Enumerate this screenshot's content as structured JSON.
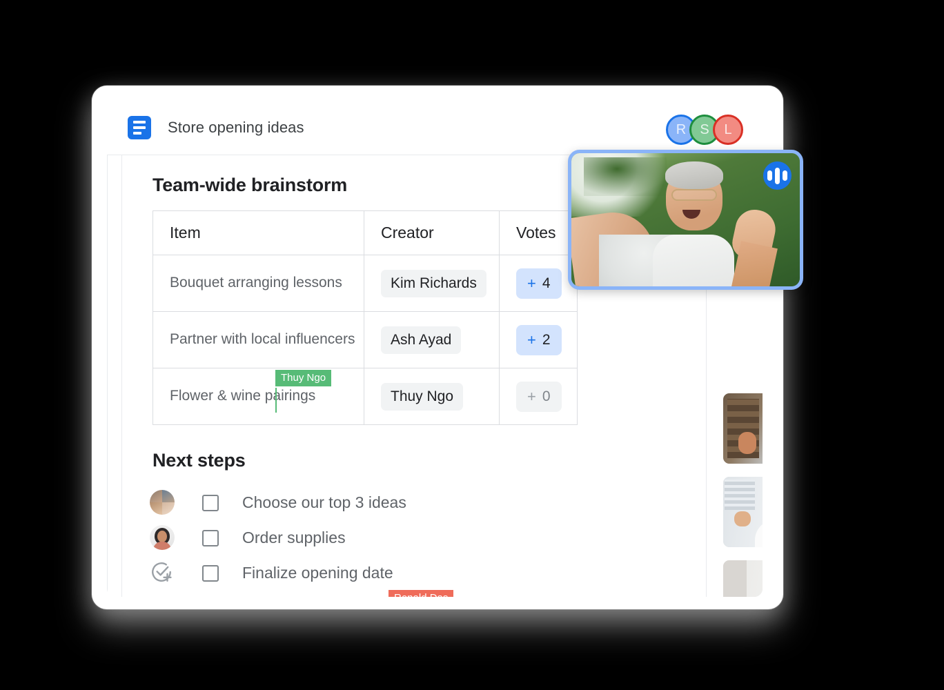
{
  "document": {
    "app_icon": "docs-icon",
    "title": "Store opening ideas",
    "collaborators": [
      {
        "initial": "R",
        "color": "#8ab4f8",
        "ring": "#1a73e8"
      },
      {
        "initial": "S",
        "color": "#81c995",
        "ring": "#1e8e3e"
      },
      {
        "initial": "L",
        "color": "#f28b82",
        "ring": "#d93025"
      }
    ],
    "brainstorm": {
      "heading": "Team-wide brainstorm",
      "columns": [
        "Item",
        "Creator",
        "Votes"
      ],
      "rows": [
        {
          "item": "Bouquet arranging lessons",
          "creator": "Kim Richards",
          "vote_plus": "+",
          "vote_count": "4",
          "vote_state": "active"
        },
        {
          "item": "Partner with local influencers",
          "creator": "Ash Ayad",
          "vote_plus": "+",
          "vote_count": "2",
          "vote_state": "active"
        },
        {
          "item": "Flower & wine pairings",
          "creator": "Thuy Ngo",
          "vote_plus": "+",
          "vote_count": "0",
          "vote_state": "zero"
        }
      ]
    },
    "next_steps": {
      "heading": "Next steps",
      "items": [
        {
          "label": "Choose our top 3 ideas",
          "assignee_icon": "group-avatar",
          "checked": false
        },
        {
          "label": "Order supplies",
          "assignee_icon": "person-avatar",
          "checked": false
        },
        {
          "label": "Finalize opening date",
          "assignee_icon": "assign-task-icon",
          "checked": false
        }
      ]
    },
    "cursors": [
      {
        "name": "Thuy Ngo",
        "color": "#57bb77"
      },
      {
        "name": "Ronald Das",
        "color": "#ef6c5a"
      }
    ]
  },
  "meeting": {
    "main_tile": {
      "speaking_badge": "audio-active-icon",
      "border_color": "#8ab4f8"
    },
    "thumbnails": [
      {
        "name": "participant-1"
      },
      {
        "name": "participant-2"
      },
      {
        "name": "participant-3"
      }
    ],
    "controls": [
      {
        "name": "microphone-button",
        "icon": "microphone-icon"
      },
      {
        "name": "camera-button",
        "icon": "video-camera-icon"
      },
      {
        "name": "more-options-button",
        "icon": "more-vertical-icon"
      },
      {
        "name": "hang-up-button",
        "icon": "phone-hangup-icon",
        "color": "#db4437"
      }
    ]
  }
}
